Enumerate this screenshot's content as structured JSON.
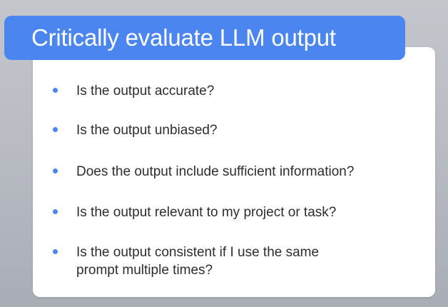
{
  "slide": {
    "title": "Critically evaluate LLM output",
    "bullets": [
      "Is the output accurate?",
      "Is the output unbiased?",
      "Does the output include sufficient information?",
      "Is the output relevant to my project or task?",
      "Is the output consistent if I use the same\nprompt multiple times?"
    ]
  },
  "colors": {
    "accent": "#4b86f0",
    "card": "#ffffff",
    "background": "#bcbfc6",
    "text": "#2b2d31"
  }
}
